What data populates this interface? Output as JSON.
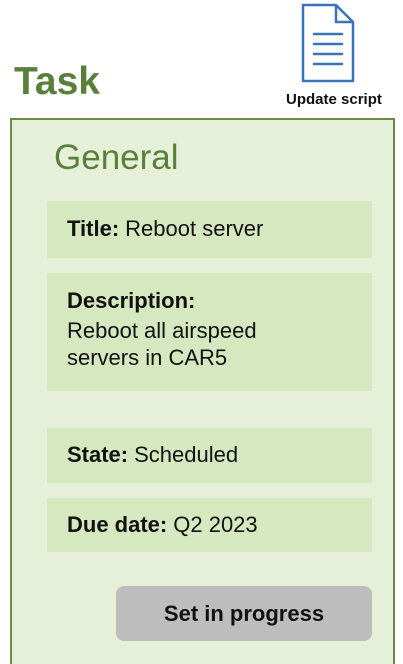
{
  "task": {
    "title": "Task"
  },
  "update_script": {
    "icon": "document-icon",
    "label": "Update script"
  },
  "section": {
    "title": "General"
  },
  "fields": {
    "title": {
      "label": "Title:",
      "value": "Reboot server"
    },
    "description": {
      "label": "Description:",
      "value": "Reboot all airspeed servers in CAR5"
    },
    "state": {
      "label": "State:",
      "value": "Scheduled"
    },
    "due_date": {
      "label": "Due date:",
      "value": "Q2 2023"
    }
  },
  "actions": {
    "set_in_progress": "Set in progress"
  },
  "colors": {
    "brand_green": "#5a7f3b",
    "panel_background": "#e6efd7",
    "field_background": "#d6e8bf",
    "button_background": "#bdbdbd",
    "icon_blue": "#3b73b7"
  }
}
